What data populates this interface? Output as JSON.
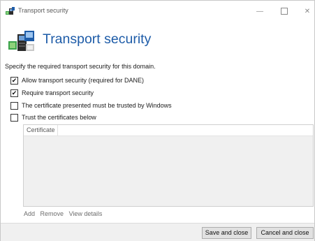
{
  "window": {
    "title": "Transport security",
    "controls": {
      "minimize": "—",
      "close": "✕"
    }
  },
  "header": {
    "title": "Transport security"
  },
  "instructions": "Specify the required transport security for this domain.",
  "options": [
    {
      "label": "Allow transport security (required for DANE)",
      "checked": true
    },
    {
      "label": "Require transport security",
      "checked": true
    },
    {
      "label": "The certificate presented must be trusted by Windows",
      "checked": false
    },
    {
      "label": "Trust the certificates below",
      "checked": false
    }
  ],
  "certificates": {
    "columns": [
      "Certificate"
    ],
    "rows": []
  },
  "actions": {
    "add": "Add",
    "remove": "Remove",
    "view_details": "View details"
  },
  "footer": {
    "save": "Save and close",
    "cancel": "Cancel and close"
  },
  "icons": {
    "app": "security-app-icon",
    "header": "transport-security-icon",
    "checked_glyph": "✔"
  },
  "colors": {
    "title_blue": "#1e5ca8",
    "footer_bg": "#f0f0f0",
    "panel_bg": "#f0f0f0"
  }
}
